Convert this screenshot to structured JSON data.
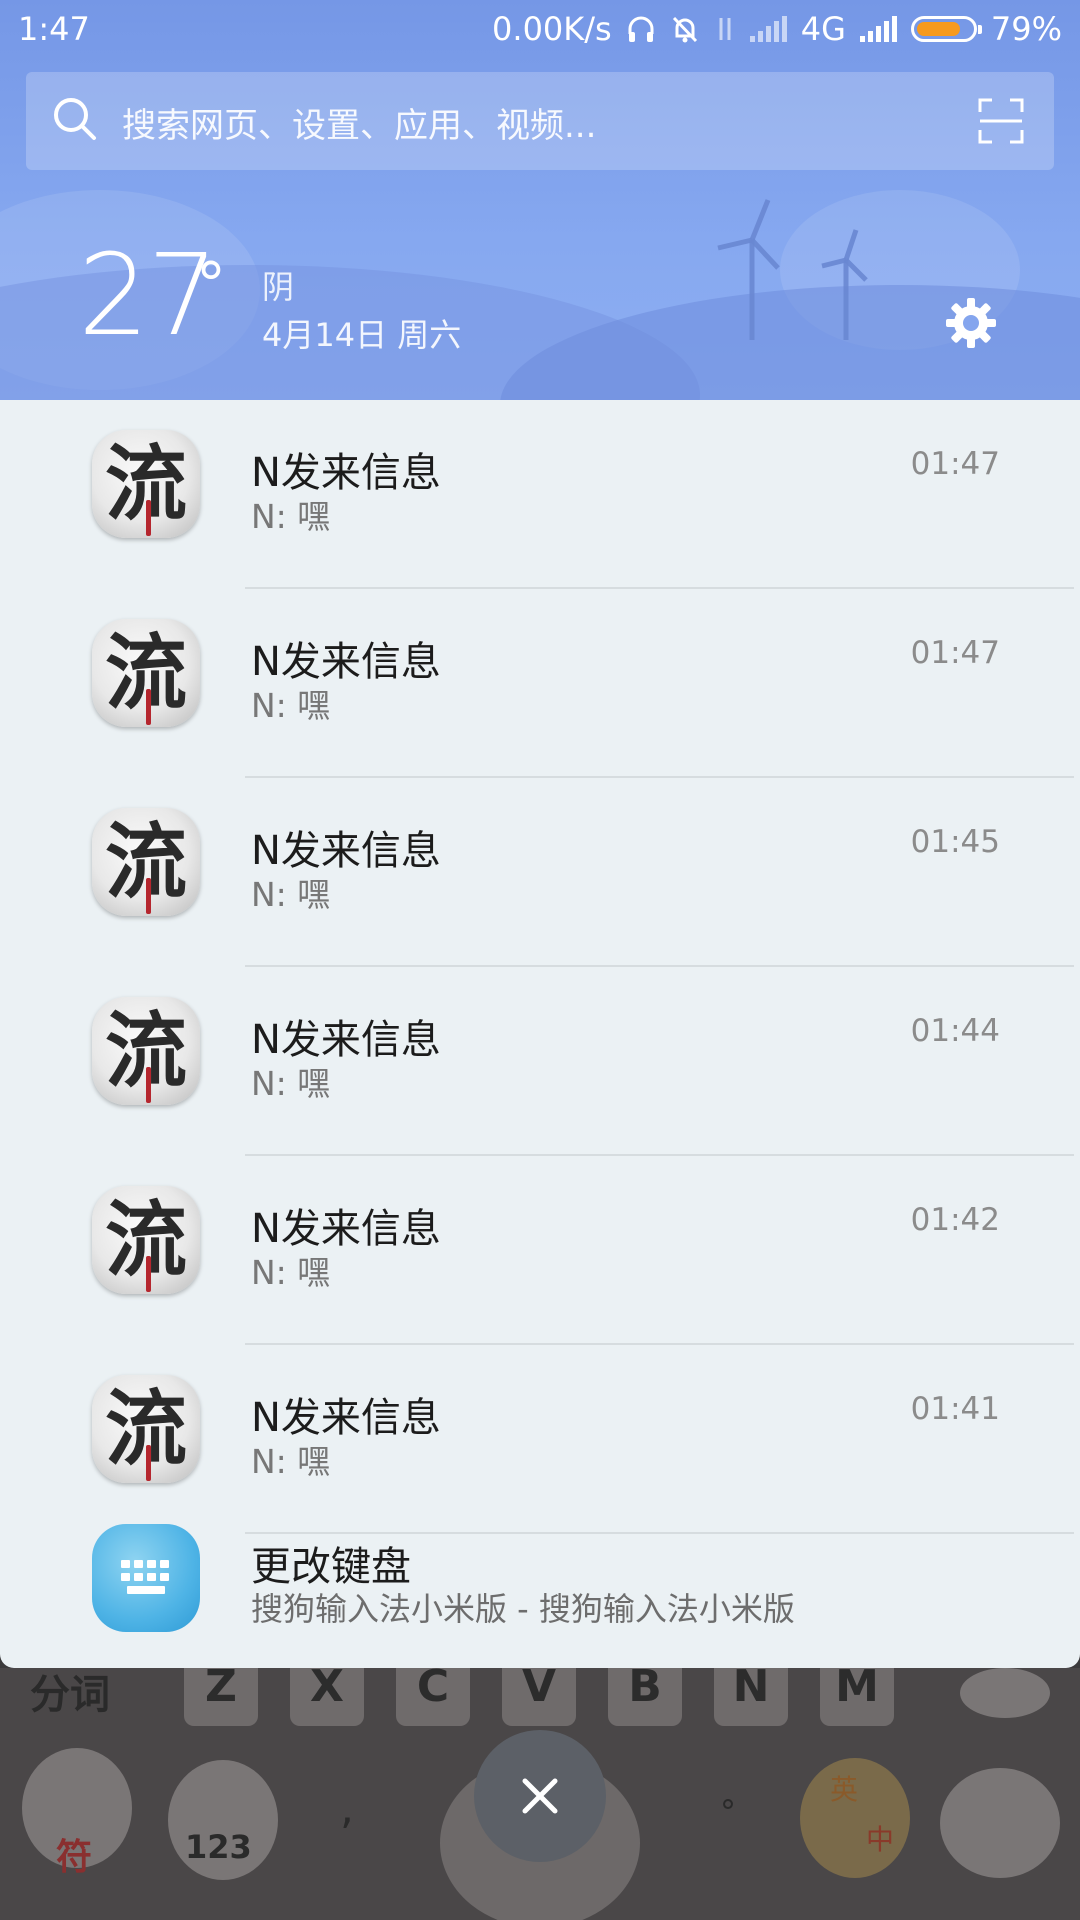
{
  "status_bar": {
    "time": "1:47",
    "net_speed": "0.00K/s",
    "network": "4G",
    "battery": "79%",
    "battery_level": 0.79
  },
  "search": {
    "placeholder": "搜索网页、设置、应用、视频..."
  },
  "weather": {
    "temperature": "27",
    "degree": "°",
    "condition": "阴",
    "date": "4月14日 周六"
  },
  "notifications": [
    {
      "title": "N发来信息",
      "text": "N: 嘿",
      "time": "01:47",
      "avatar_char": "流"
    },
    {
      "title": "N发来信息",
      "text": "N: 嘿",
      "time": "01:47",
      "avatar_char": "流"
    },
    {
      "title": "N发来信息",
      "text": "N: 嘿",
      "time": "01:45",
      "avatar_char": "流"
    },
    {
      "title": "N发来信息",
      "text": "N: 嘿",
      "time": "01:44",
      "avatar_char": "流"
    },
    {
      "title": "N发来信息",
      "text": "N: 嘿",
      "time": "01:42",
      "avatar_char": "流"
    },
    {
      "title": "N发来信息",
      "text": "N: 嘿",
      "time": "01:41",
      "avatar_char": "流"
    }
  ],
  "keyboard_notification": {
    "title": "更改键盘",
    "text": "搜狗输入法小米版 - 搜狗输入法小米版"
  },
  "keyboard": {
    "keys": [
      "Z",
      "X",
      "C",
      "V",
      "B",
      "N",
      "M"
    ],
    "left_label": "分词",
    "symbol_key": "符",
    "number_key": "123",
    "comma": ",",
    "period": "°",
    "lang_top": "英",
    "lang_bottom": "中"
  },
  "icons": {
    "search": "search-icon",
    "scan": "scan-icon",
    "settings": "gear-icon",
    "close": "close-icon",
    "keyboard": "keyboard-icon",
    "headphones": "headphones-icon",
    "bell_muted": "bell-off-icon"
  },
  "colors": {
    "header_bg": "#7f9fea",
    "panel_bg": "#ebf1f4",
    "battery_fill": "#f79a1e",
    "keyboard_icon": "#4fb4e6"
  }
}
